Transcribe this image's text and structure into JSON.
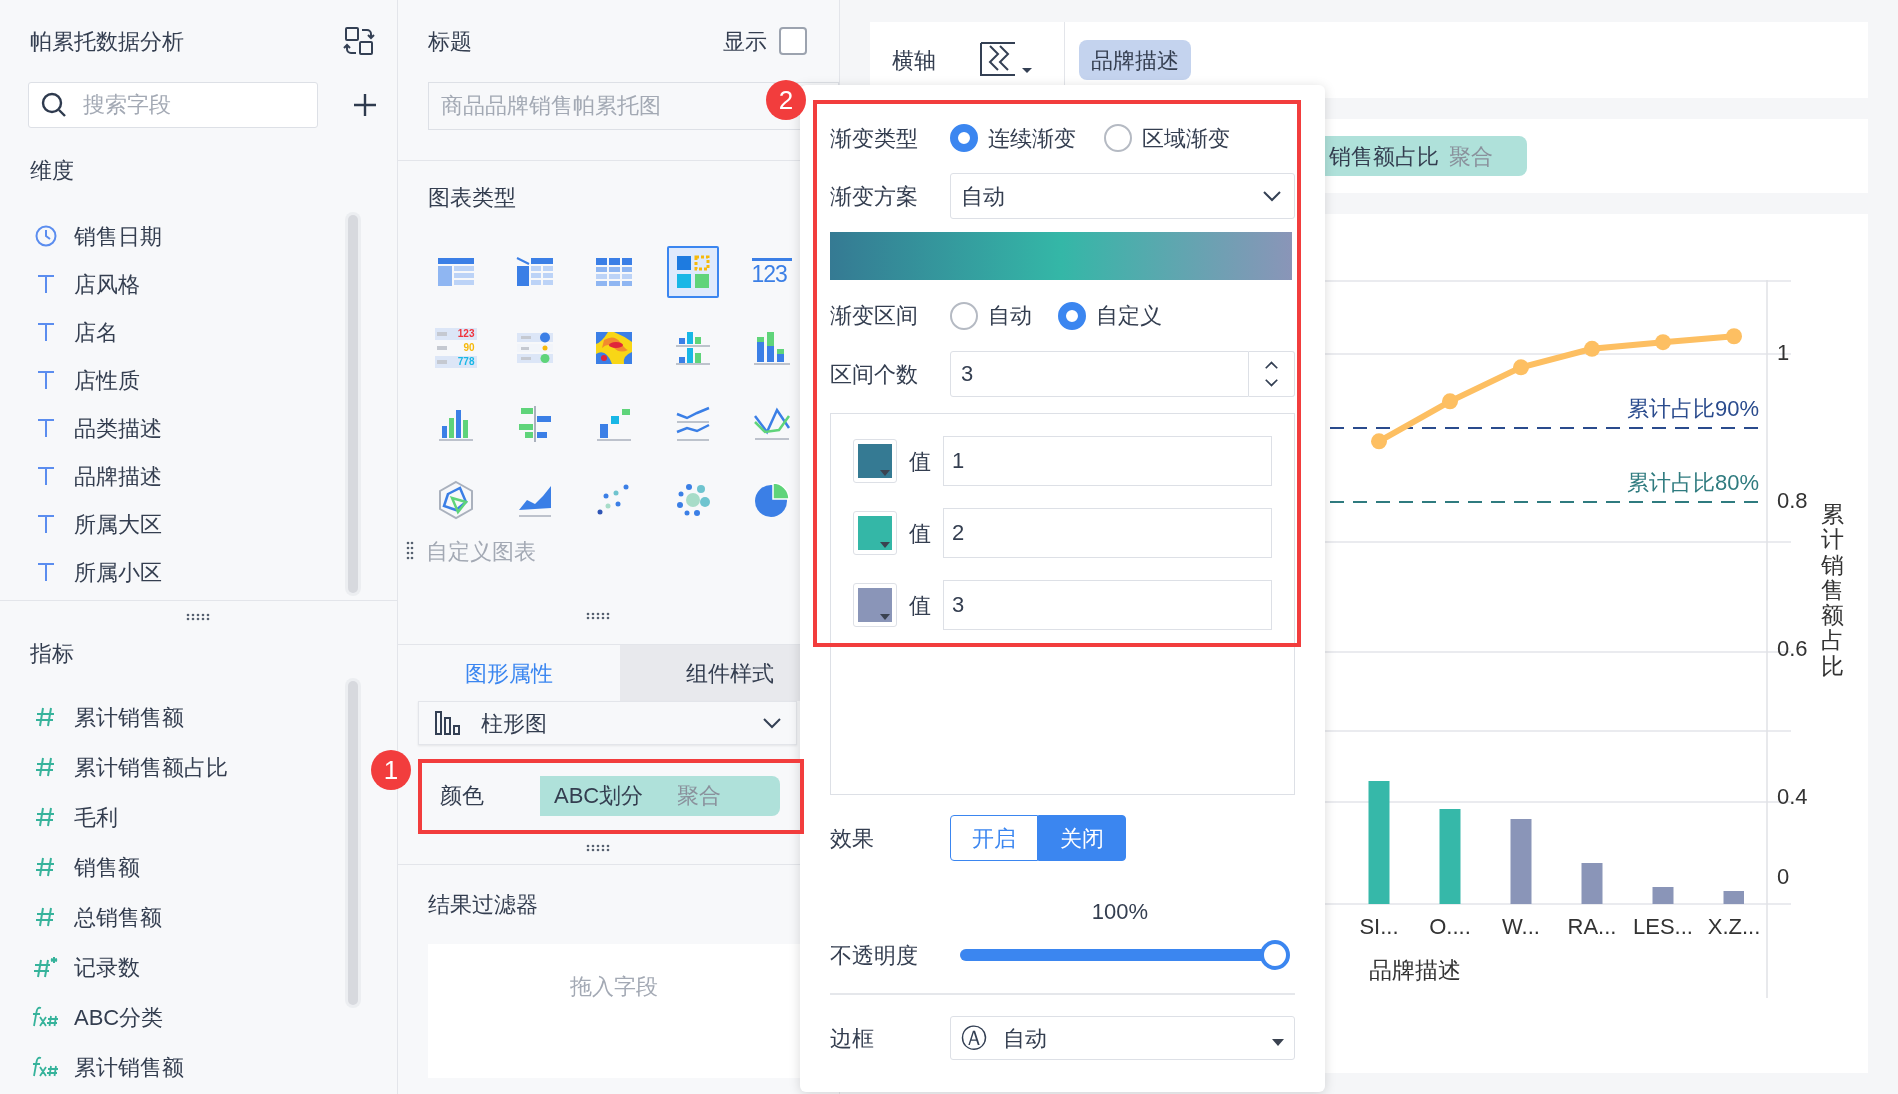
{
  "sidebar": {
    "title": "帕累托数据分析",
    "search": {
      "placeholder": "搜索字段"
    },
    "dimensions": {
      "heading": "维度",
      "items": [
        {
          "kind": "date",
          "label": "销售日期"
        },
        {
          "kind": "text",
          "label": "店风格"
        },
        {
          "kind": "text",
          "label": "店名"
        },
        {
          "kind": "text",
          "label": "店性质"
        },
        {
          "kind": "text",
          "label": "品类描述"
        },
        {
          "kind": "text",
          "label": "品牌描述"
        },
        {
          "kind": "text",
          "label": "所属大区"
        },
        {
          "kind": "text",
          "label": "所属小区"
        }
      ]
    },
    "measures": {
      "heading": "指标",
      "items": [
        {
          "kind": "number",
          "label": "累计销售额"
        },
        {
          "kind": "number",
          "label": "累计销售额占比"
        },
        {
          "kind": "number",
          "label": "毛利"
        },
        {
          "kind": "number",
          "label": "销售额"
        },
        {
          "kind": "number",
          "label": "总销售额"
        },
        {
          "kind": "count",
          "label": "记录数"
        },
        {
          "kind": "calc",
          "label": "ABC分类"
        },
        {
          "kind": "calc",
          "label": "累计销售额"
        }
      ]
    }
  },
  "config": {
    "title": {
      "label": "标题",
      "show_label": "显示",
      "show": false,
      "placeholder": "商品品牌销售帕累托图"
    },
    "chart_types": {
      "heading": "图表类型",
      "custom": "自定义图表",
      "items": [
        {
          "kind": "table",
          "selected": false
        },
        {
          "kind": "crosstab",
          "selected": false
        },
        {
          "kind": "grid",
          "selected": false
        },
        {
          "kind": "treemap",
          "selected": true
        },
        {
          "kind": "number",
          "label": "123",
          "selected": false
        },
        {
          "kind": "kpi",
          "labels": [
            "123",
            "90",
            "778"
          ],
          "selected": false
        },
        {
          "kind": "dot-table",
          "selected": false
        },
        {
          "kind": "heatmap",
          "selected": false
        },
        {
          "kind": "grouped",
          "selected": false
        },
        {
          "kind": "stacked",
          "selected": false
        },
        {
          "kind": "bar",
          "selected": false
        },
        {
          "kind": "diverging",
          "selected": false
        },
        {
          "kind": "waterfall",
          "selected": false
        },
        {
          "kind": "multi-line",
          "selected": false
        },
        {
          "kind": "line",
          "selected": false
        },
        {
          "kind": "radar",
          "selected": false
        },
        {
          "kind": "area",
          "selected": false
        },
        {
          "kind": "scatter",
          "selected": false
        },
        {
          "kind": "bubble",
          "selected": false
        },
        {
          "kind": "pie",
          "selected": false
        }
      ]
    },
    "tabs": [
      {
        "label": "图形属性",
        "selected": true
      },
      {
        "label": "组件样式",
        "selected": false
      }
    ],
    "chart_select": "柱形图",
    "color": {
      "label": "颜色",
      "field": "ABC划分",
      "aggregation": "聚合"
    },
    "filter": {
      "heading": "结果过滤器",
      "placeholder": "拖入字段"
    }
  },
  "callouts": [
    {
      "label": "1"
    },
    {
      "label": "2"
    }
  ],
  "axis_bar": {
    "label": "横轴",
    "field": "品牌描述"
  },
  "value_bar": {
    "field": "销售额占比",
    "aggregation": "聚合"
  },
  "popup": {
    "gradient_type": {
      "label": "渐变类型",
      "options": [
        {
          "label": "连续渐变",
          "selected": true
        },
        {
          "label": "区域渐变",
          "selected": false
        }
      ]
    },
    "gradient_scheme": {
      "label": "渐变方案",
      "value": "自动"
    },
    "gradient_range": {
      "label": "渐变区间",
      "options": [
        {
          "label": "自动",
          "selected": false
        },
        {
          "label": "自定义",
          "selected": true
        }
      ]
    },
    "interval_count": {
      "label": "区间个数",
      "value": "3"
    },
    "stops": [
      {
        "color": "#357a93",
        "label": "值",
        "value": "1"
      },
      {
        "color": "#34b7a7",
        "label": "值",
        "value": "2"
      },
      {
        "color": "#8a95b8",
        "label": "值",
        "value": "3"
      }
    ],
    "effect": {
      "label": "效果",
      "options": [
        {
          "label": "开启",
          "selected": false
        },
        {
          "label": "关闭",
          "selected": true
        }
      ]
    },
    "opacity": {
      "label": "不透明度",
      "reading": "100%",
      "level": 1
    },
    "border": {
      "label": "边框",
      "icon": "Ⓐ",
      "value": "自动"
    }
  },
  "chart": {
    "bar_axis_ticks": [
      "0"
    ],
    "chart_data": {
      "type": "line",
      "xlabel": "品牌描述",
      "ylabel": "累计销售额占比",
      "categories": [
        "SI...",
        "O....",
        "W...",
        "RA...",
        "LES...",
        "X.Z..."
      ],
      "ylim": [
        0.1373,
        1.1
      ],
      "yticks": [
        0.4,
        0.6,
        0.8,
        1
      ],
      "grid": true,
      "series": [
        {
          "color": "#fdbf62",
          "marker": true,
          "values": [
            0.882,
            0.936,
            0.982,
            1.007,
            1.016,
            1.024
          ]
        }
      ],
      "ref_lines": [
        {
          "axis": "y",
          "value": 0.9,
          "label": "累计占比90%",
          "color": "#2a4b8d"
        },
        {
          "axis": "y",
          "value": 0.8,
          "label": "累计占比80%",
          "color": "#2f7b7f"
        }
      ]
    }
  }
}
